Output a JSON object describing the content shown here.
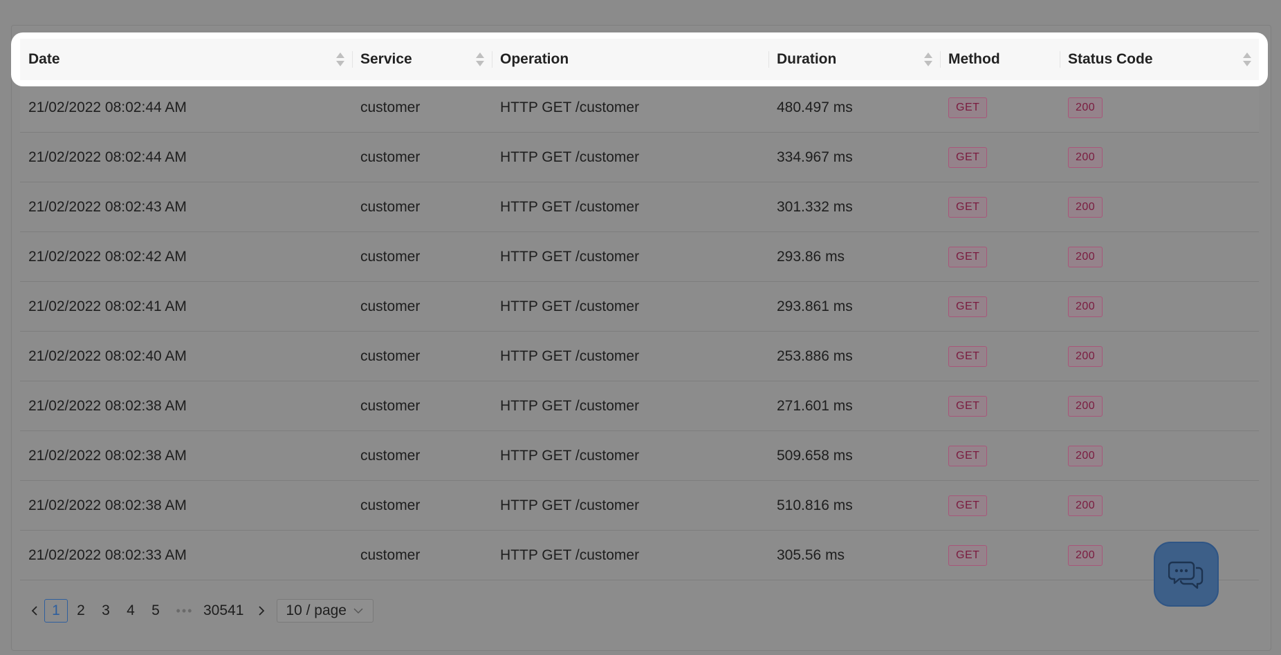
{
  "table": {
    "columns": [
      {
        "label": "Date",
        "sortable": true
      },
      {
        "label": "Service",
        "sortable": true
      },
      {
        "label": "Operation",
        "sortable": false
      },
      {
        "label": "Duration",
        "sortable": true
      },
      {
        "label": "Method",
        "sortable": false
      },
      {
        "label": "Status Code",
        "sortable": true
      }
    ],
    "rows": [
      {
        "date": "21/02/2022 08:02:44 AM",
        "service": "customer",
        "operation": "HTTP GET /customer",
        "duration": "480.497 ms",
        "method": "GET",
        "status": "200"
      },
      {
        "date": "21/02/2022 08:02:44 AM",
        "service": "customer",
        "operation": "HTTP GET /customer",
        "duration": "334.967 ms",
        "method": "GET",
        "status": "200"
      },
      {
        "date": "21/02/2022 08:02:43 AM",
        "service": "customer",
        "operation": "HTTP GET /customer",
        "duration": "301.332 ms",
        "method": "GET",
        "status": "200"
      },
      {
        "date": "21/02/2022 08:02:42 AM",
        "service": "customer",
        "operation": "HTTP GET /customer",
        "duration": "293.86 ms",
        "method": "GET",
        "status": "200"
      },
      {
        "date": "21/02/2022 08:02:41 AM",
        "service": "customer",
        "operation": "HTTP GET /customer",
        "duration": "293.861 ms",
        "method": "GET",
        "status": "200"
      },
      {
        "date": "21/02/2022 08:02:40 AM",
        "service": "customer",
        "operation": "HTTP GET /customer",
        "duration": "253.886 ms",
        "method": "GET",
        "status": "200"
      },
      {
        "date": "21/02/2022 08:02:38 AM",
        "service": "customer",
        "operation": "HTTP GET /customer",
        "duration": "271.601 ms",
        "method": "GET",
        "status": "200"
      },
      {
        "date": "21/02/2022 08:02:38 AM",
        "service": "customer",
        "operation": "HTTP GET /customer",
        "duration": "509.658 ms",
        "method": "GET",
        "status": "200"
      },
      {
        "date": "21/02/2022 08:02:38 AM",
        "service": "customer",
        "operation": "HTTP GET /customer",
        "duration": "510.816 ms",
        "method": "GET",
        "status": "200"
      },
      {
        "date": "21/02/2022 08:02:33 AM",
        "service": "customer",
        "operation": "HTTP GET /customer",
        "duration": "305.56 ms",
        "method": "GET",
        "status": "200"
      }
    ]
  },
  "pagination": {
    "pages": [
      "1",
      "2",
      "3",
      "4",
      "5"
    ],
    "active": "1",
    "ellipsis": "•••",
    "last_page": "30541",
    "page_size": "10 / page",
    "prev_icon": "chevron-left-icon",
    "next_icon": "chevron-right-icon"
  },
  "chat": {
    "icon": "chat-bubbles-icon"
  },
  "colors": {
    "overlay": "#8b8b8b",
    "header_bg": "#ffffff",
    "tag_text": "#7a1b3f",
    "tag_border": "#a8567a",
    "active_page": "#2e5f9e",
    "chat_bg": "#3d5f88"
  }
}
